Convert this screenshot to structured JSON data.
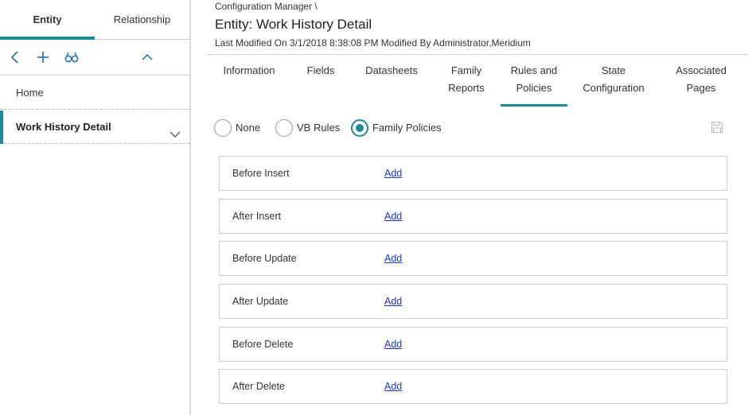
{
  "left_panel": {
    "tabs": [
      {
        "label": "Entity"
      },
      {
        "label": "Relationship"
      }
    ],
    "toolbar": {
      "back_icon": "chevron-left-icon",
      "add_icon": "plus-icon",
      "search_icon": "binoculars-icon",
      "collapse_icon": "chevron-up-icon"
    },
    "nav": {
      "home": "Home",
      "active_item": "Work History Detail"
    }
  },
  "header": {
    "breadcrumb": "Configuration Manager \\",
    "title": "Entity: Work History Detail",
    "modified": "Last Modified On 3/1/2018 8:38:08 PM Modified By Administrator,Meridium"
  },
  "tabs": [
    {
      "line1": "Information",
      "line2": ""
    },
    {
      "line1": "Fields",
      "line2": ""
    },
    {
      "line1": "Datasheets",
      "line2": ""
    },
    {
      "line1": "Family",
      "line2": "Reports"
    },
    {
      "line1": "Rules and",
      "line2": "Policies"
    },
    {
      "line1": "State",
      "line2": "Configuration"
    },
    {
      "line1": "Associated",
      "line2": "Pages"
    }
  ],
  "active_tab": "Rules and Policies",
  "rule_type": {
    "options": [
      "None",
      "VB Rules",
      "Family Policies"
    ],
    "selected": "Family Policies"
  },
  "policy_rows": [
    {
      "label": "Before Insert",
      "action": "Add"
    },
    {
      "label": "After Insert",
      "action": "Add"
    },
    {
      "label": "Before Update",
      "action": "Add"
    },
    {
      "label": "After Update",
      "action": "Add"
    },
    {
      "label": "Before Delete",
      "action": "Add"
    },
    {
      "label": "After Delete",
      "action": "Add"
    }
  ],
  "colors": {
    "accent": "#1d8a9a",
    "link": "#1a35c7"
  }
}
